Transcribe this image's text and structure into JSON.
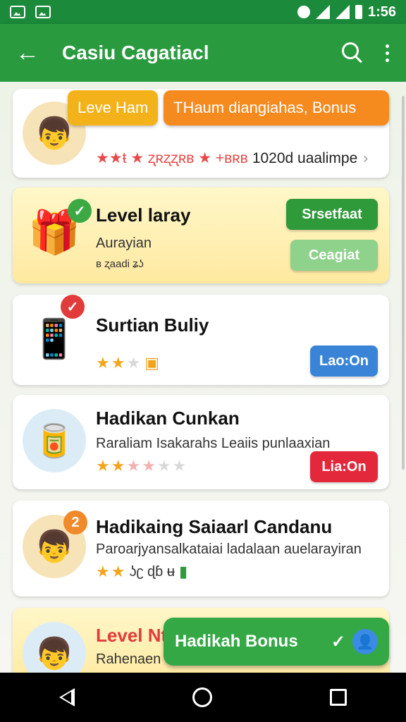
{
  "statusbar": {
    "time": "1:56"
  },
  "appbar": {
    "title": "Casiu Cagatiacl"
  },
  "top_tabs": {
    "left": "Leve Ham",
    "right": "THaum diangiahas, Bonus"
  },
  "cards": [
    {
      "title": "",
      "stars_text": "★★ŧ ★ ʐʀʐʐʀʙ ★ +ʙʀʙ",
      "sub": "1020d uaalimpe",
      "avatar": "👦"
    },
    {
      "title": "Level laray",
      "sub": "Aurayian",
      "small": "ʙ ʐaadi ʑʖ",
      "buttons": [
        "Srsetfaat",
        "Ceagiat"
      ],
      "avatar": "🎁"
    },
    {
      "title": "Surtian Buliy",
      "button": "Lao:On",
      "avatar": "📱"
    },
    {
      "title": "Hadikan Cunkan",
      "sub": "Raraliam Isakarahs Leaiis punlaaxian",
      "button": "Lia:On",
      "avatar": "🥫"
    },
    {
      "title": "Hadikaing Saiaarl Candanu",
      "sub": "Paroarjyansalkataiai ladalaan auelarayiran",
      "stars_tail": "ʖʗ ɖɓ ʉ",
      "avatar": "👦",
      "badge": "2"
    },
    {
      "title": "Level Nt",
      "sub": "Rahenaen",
      "avatar": "👦"
    }
  ],
  "fab": {
    "label": "Hadikah Bonus"
  }
}
